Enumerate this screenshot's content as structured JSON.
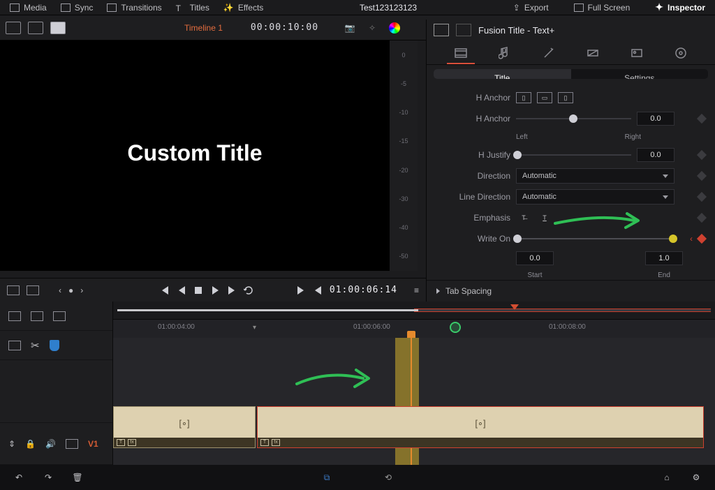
{
  "topmenu": {
    "media": "Media",
    "sync": "Sync",
    "transitions": "Transitions",
    "titles": "Titles",
    "effects": "Effects",
    "project": "Test123123123",
    "export": "Export",
    "fullscreen": "Full Screen",
    "inspector": "Inspector"
  },
  "secondbar": {
    "timeline_name": "Timeline 1",
    "timecode": "00:00:10:00"
  },
  "viewer": {
    "title_text": "Custom Title",
    "vruler": [
      "0",
      "-5",
      "-10",
      "-15",
      "-20",
      "-30",
      "-40",
      "-50"
    ]
  },
  "inspector": {
    "title": "Fusion Title - Text+",
    "tab_title": "Title",
    "tab_settings": "Settings",
    "hanchor_label": "H Anchor",
    "hanchor2_label": "H Anchor",
    "hanchor2_val": "0.0",
    "left": "Left",
    "right": "Right",
    "hjustify_label": "H Justify",
    "hjustify_val": "0.0",
    "direction_label": "Direction",
    "direction_val": "Automatic",
    "linedir_label": "Line Direction",
    "linedir_val": "Automatic",
    "emphasis_label": "Emphasis",
    "writeon_label": "Write On",
    "writeon_start_val": "0.0",
    "writeon_end_val": "1.0",
    "writeon_start_lbl": "Start",
    "writeon_end_lbl": "End",
    "tab_spacing": "Tab Spacing"
  },
  "transport": {
    "timecode": "01:00:06:14"
  },
  "timeline": {
    "ruler": [
      "01:00:04:00",
      "01:00:06:00",
      "01:00:08:00"
    ],
    "track_label": "V1"
  }
}
